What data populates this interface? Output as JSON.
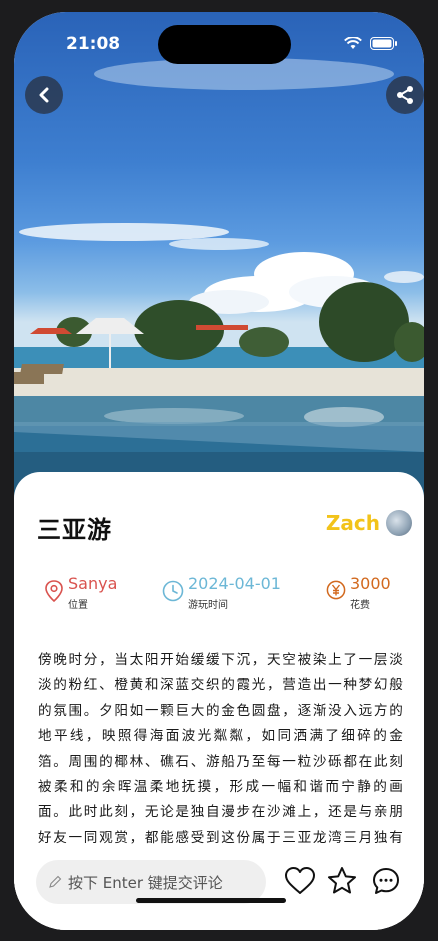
{
  "status_bar": {
    "time": "21:08"
  },
  "header": {
    "back_icon": "chevron-left-icon",
    "share_icon": "share-icon"
  },
  "post": {
    "title": "三亚游",
    "author_name": "Zach",
    "location": {
      "value": "Sanya",
      "label": "位置",
      "color": "#d9534f"
    },
    "date": {
      "value": "2024-04-01",
      "label": "游玩时间",
      "color": "#6cb7d6"
    },
    "cost": {
      "value": "3000",
      "label": "花费",
      "color": "#d2691e"
    },
    "description": "傍晚时分，当太阳开始缓缓下沉，天空被染上了一层淡淡的粉红、橙黄和深蓝交织的霞光，营造出一种梦幻般的氛围。夕阳如一颗巨大的金色圆盘，逐渐没入远方的地平线，映照得海面波光粼粼，如同洒满了细碎的金箔。周围的椰林、礁石、游船乃至每一粒沙砾都在此刻被柔和的余晖温柔地抚摸，形成一幅和谐而宁静的画面。此时此刻，无论是独自漫步在沙滩上，还是与亲朋好友一同观赏，都能感受到这份属于三亚龙湾三月独有的"
  },
  "bottom_bar": {
    "comment_placeholder": "按下 Enter 键提交评论",
    "like_icon": "heart-icon",
    "favorite_icon": "star-icon",
    "comments_icon": "chat-bubble-icon"
  }
}
